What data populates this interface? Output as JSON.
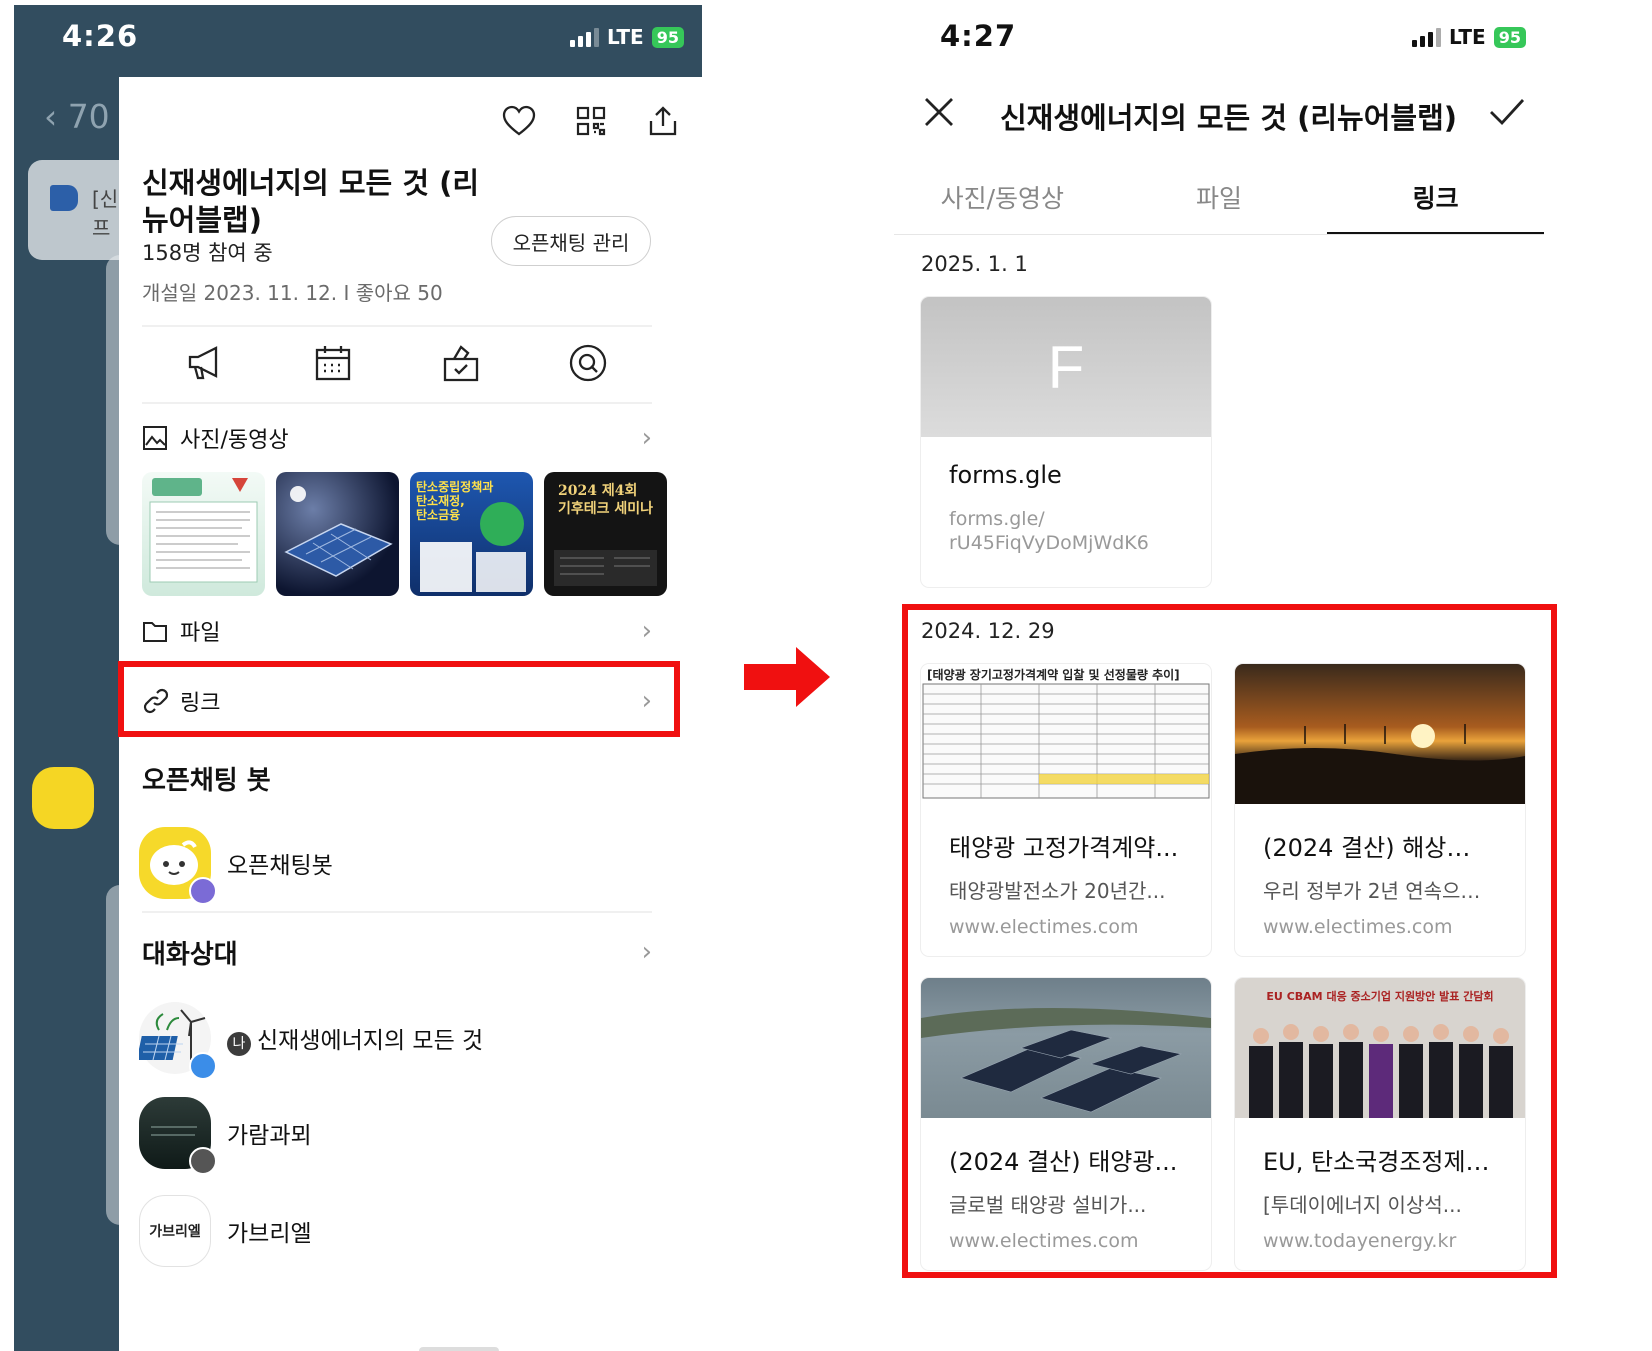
{
  "left": {
    "status": {
      "time": "4:26",
      "network": "LTE",
      "battery": "95"
    },
    "background_chat": {
      "back_text": "70",
      "notice_text": "[신\n프"
    },
    "drawer": {
      "room_title": "신재생에너지의 모든 것 (리뉴어블랩)",
      "member_count": "158명 참여 중",
      "manage_button": "오픈채팅 관리",
      "open_info": "개설일 2023. 11. 12. I 좋아요 50",
      "photos_label": "사진/동영상",
      "thumbnails": [
        {
          "text": "",
          "color": "#dff1ea"
        },
        {
          "text": "",
          "color": "#1b2540"
        },
        {
          "text": "탄소중립정책과\n탄소재정,\n탄소금융",
          "color": "#1f4fa0"
        },
        {
          "text": "2024 제4회\n기후테크 세미나",
          "color": "#151515"
        }
      ],
      "files_label": "파일",
      "links_label": "링크",
      "bot_section": "오픈채팅 봇",
      "bot_name": "오픈채팅봇",
      "members_section": "대화상대",
      "members": [
        {
          "name": "신재생에너지의 모든 것",
          "badge": "나"
        },
        {
          "name": "가람과뫼"
        },
        {
          "name": "가브리엘",
          "avatar_text": "가브리엘"
        }
      ]
    }
  },
  "right": {
    "status": {
      "time": "4:27",
      "network": "LTE",
      "battery": "95"
    },
    "title": "신재생에너지의 모든 것 (리뉴어블랩)",
    "tabs": [
      "사진/동영상",
      "파일",
      "링크"
    ],
    "active_tab": "링크",
    "groups": [
      {
        "date": "2025. 1. 1",
        "links": [
          {
            "image_letter": "F",
            "title": "forms.gle",
            "url": "forms.gle/\nrU45FiqVyDoMjWdK6"
          }
        ]
      },
      {
        "date": "2024. 12. 29",
        "links": [
          {
            "image_caption": "[태양광 장기고정가격계약 입찰 및 선정물량 추이]",
            "title": "태양광 고정가격계약...",
            "desc": "태양광발전소가 20년간...",
            "url": "www.electimes.com"
          },
          {
            "title": "(2024 결산) 해상…",
            "desc": "우리 정부가 2년 연속으…",
            "url": "www.electimes.com"
          },
          {
            "title": "(2024 결산) 태양광...",
            "desc": "글로벌 태양광 설비가...",
            "url": "www.electimes.com"
          },
          {
            "image_caption": "EU CBAM 대응 중소기업 지원방안 발표 간담회",
            "title": "EU, 탄소국경조정제…",
            "desc": "[투데이에너지 이상석...",
            "url": "www.todayenergy.kr"
          }
        ]
      }
    ]
  },
  "colors": {
    "highlight": "#f01010",
    "left_bg": "#324d5f",
    "battery": "#36c759"
  }
}
